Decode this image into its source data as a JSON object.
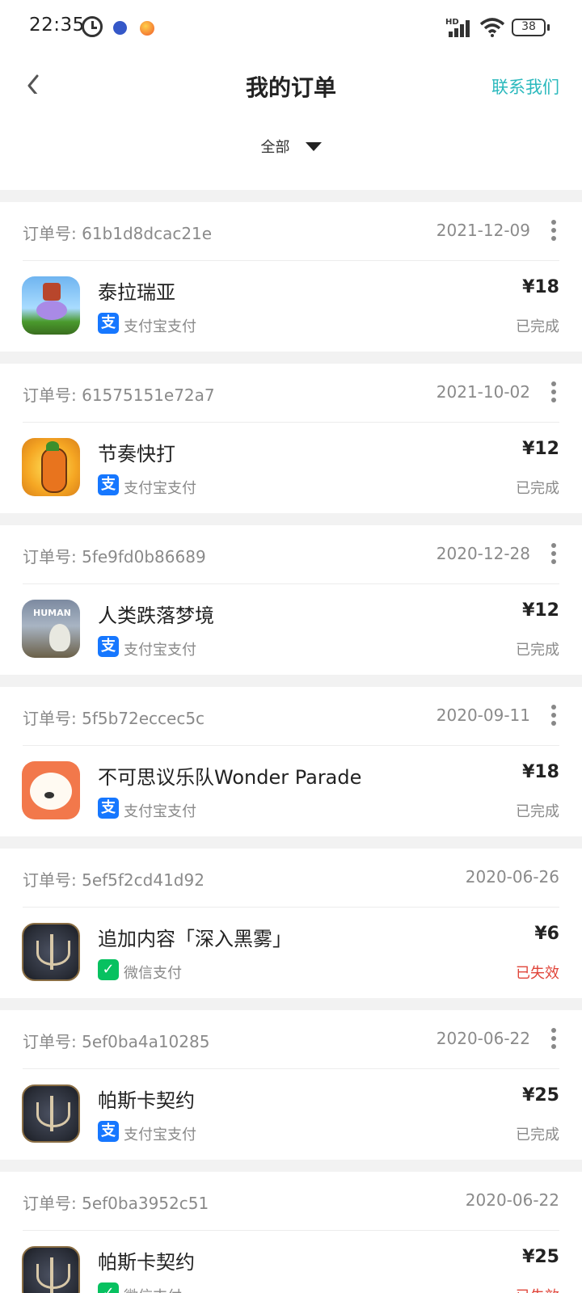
{
  "status_bar": {
    "time": "22:35",
    "battery": "38",
    "signal_label": "HD"
  },
  "header": {
    "title": "我的订单",
    "contact": "联系我们"
  },
  "filter": {
    "selected": "全部"
  },
  "colors": {
    "accent": "#2bb9bd",
    "failed": "#e0453a",
    "alipay": "#1677ff",
    "wechat": "#07c160"
  },
  "orders": [
    {
      "order_no": "订单号: 61b1d8dcac21e",
      "date": "2021-12-09",
      "name": "泰拉瑞亚",
      "pay": "支付宝支付",
      "pay_type": "alipay",
      "price": "¥18",
      "status": "已完成",
      "failed": false,
      "more": true,
      "icon": "terraria-icon"
    },
    {
      "order_no": "订单号: 61575151e72a7",
      "date": "2021-10-02",
      "name": "节奏快打",
      "pay": "支付宝支付",
      "pay_type": "alipay",
      "price": "¥12",
      "status": "已完成",
      "failed": false,
      "more": true,
      "icon": "rhythm-icon"
    },
    {
      "order_no": "订单号: 5fe9fd0b86689",
      "date": "2020-12-28",
      "name": "人类跌落梦境",
      "pay": "支付宝支付",
      "pay_type": "alipay",
      "price": "¥12",
      "status": "已完成",
      "failed": false,
      "more": true,
      "icon": "human-icon"
    },
    {
      "order_no": "订单号: 5f5b72eccec5c",
      "date": "2020-09-11",
      "name": "不可思议乐队Wonder Parade",
      "pay": "支付宝支付",
      "pay_type": "alipay",
      "price": "¥18",
      "status": "已完成",
      "failed": false,
      "more": true,
      "icon": "bear-icon"
    },
    {
      "order_no": "订单号: 5ef5f2cd41d92",
      "date": "2020-06-26",
      "name": "追加内容「深入黑雾」",
      "pay": "微信支付",
      "pay_type": "wechat",
      "price": "¥6",
      "status": "已失效",
      "failed": true,
      "more": false,
      "icon": "pascal-icon"
    },
    {
      "order_no": "订单号: 5ef0ba4a10285",
      "date": "2020-06-22",
      "name": "帕斯卡契约",
      "pay": "支付宝支付",
      "pay_type": "alipay",
      "price": "¥25",
      "status": "已完成",
      "failed": false,
      "more": true,
      "icon": "pascal-icon"
    },
    {
      "order_no": "订单号: 5ef0ba3952c51",
      "date": "2020-06-22",
      "name": "帕斯卡契约",
      "pay": "微信支付",
      "pay_type": "wechat",
      "price": "¥25",
      "status": "已失效",
      "failed": true,
      "more": false,
      "icon": "pascal-icon"
    }
  ]
}
